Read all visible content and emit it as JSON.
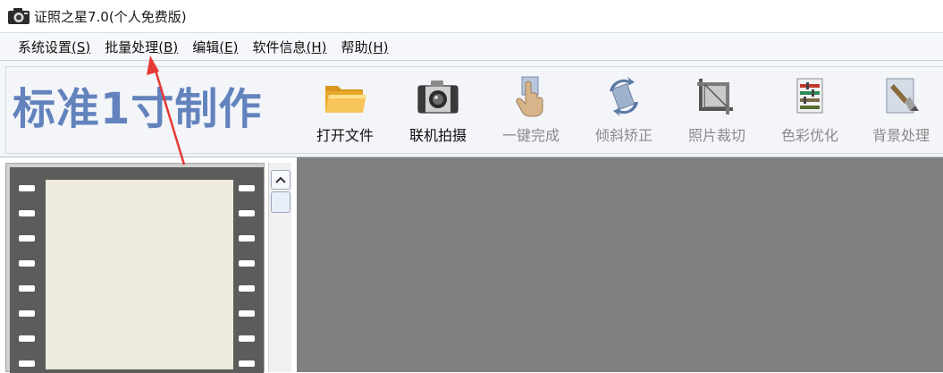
{
  "window": {
    "title": "证照之星7.0(个人免费版)",
    "icon": "camera-icon"
  },
  "menu": [
    {
      "label": "系统设置",
      "mnemonic": "(S)"
    },
    {
      "label": "批量处理",
      "mnemonic": "(B)"
    },
    {
      "label": "编辑",
      "mnemonic": "(E)"
    },
    {
      "label": "软件信息",
      "mnemonic": "(H)"
    },
    {
      "label": "帮助",
      "mnemonic": "(H)"
    }
  ],
  "toolbar": {
    "mode_title": "标准1寸制作",
    "tools": [
      {
        "label": "打开文件",
        "icon": "folder-icon",
        "enabled": true
      },
      {
        "label": "联机拍摄",
        "icon": "camera-icon",
        "enabled": true
      },
      {
        "label": "一键完成",
        "icon": "hand-click-icon",
        "enabled": false
      },
      {
        "label": "倾斜矫正",
        "icon": "rotate-icon",
        "enabled": false
      },
      {
        "label": "照片裁切",
        "icon": "crop-icon",
        "enabled": false
      },
      {
        "label": "色彩优化",
        "icon": "color-sliders-icon",
        "enabled": false
      },
      {
        "label": "背景处理",
        "icon": "brush-icon",
        "enabled": false
      }
    ]
  },
  "colors": {
    "mode_title": "#6383bd",
    "workspace": "#808080",
    "film": "#5c5c5c",
    "frame": "#eeeadc",
    "arrow": "#e53935"
  }
}
